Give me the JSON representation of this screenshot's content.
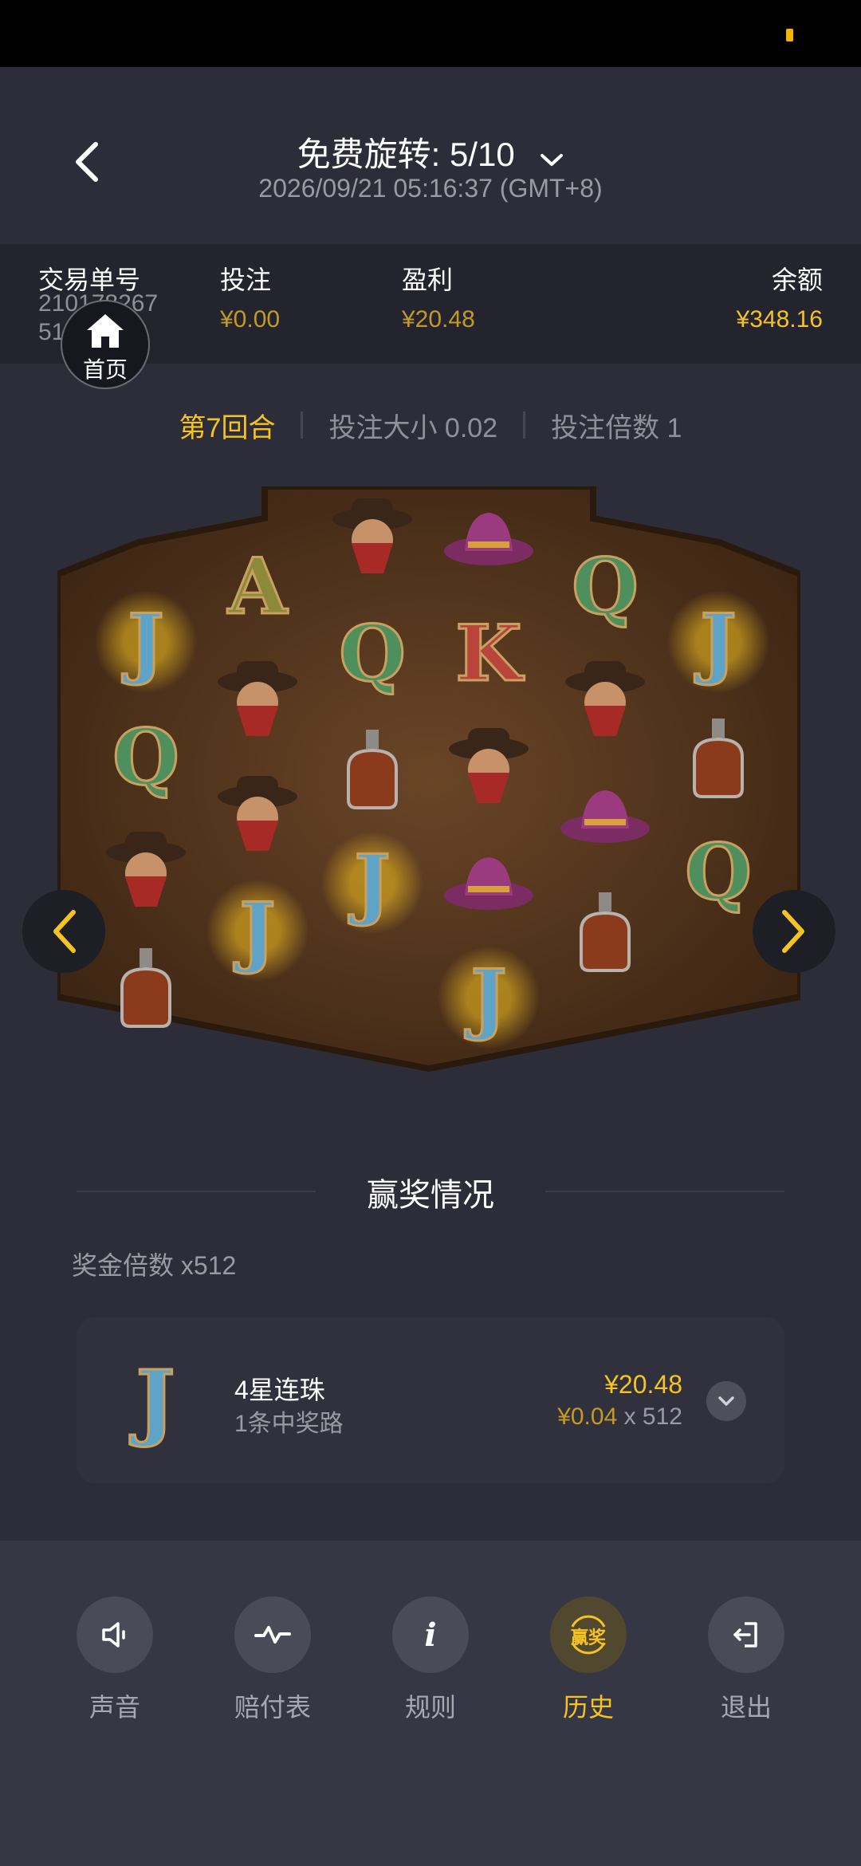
{
  "header": {
    "title": "免费旋转: 5/10",
    "timestamp": "2026/09/21 05:16:37 (GMT+8)"
  },
  "info": {
    "order_label": "交易单号",
    "order_line1": "210178267",
    "order_line2": "5110...113",
    "bet_label": "投注",
    "bet_value": "¥0.00",
    "profit_label": "盈利",
    "profit_value": "¥20.48",
    "balance_label": "余额",
    "balance_value": "¥348.16",
    "home_label": "首页"
  },
  "round": {
    "round_label": "第7回合",
    "bet_size": "投注大小 0.02",
    "bet_multiplier": "投注倍数 1"
  },
  "reels": [
    [
      "J",
      "Q",
      "bandit",
      "bottle"
    ],
    [
      "A",
      "bandit",
      "bandit",
      "J"
    ],
    [
      "bandit",
      "Q",
      "bottle",
      "J"
    ],
    [
      "hat",
      "K",
      "bandit",
      "hat",
      "J"
    ],
    [
      "Q",
      "bandit",
      "hat",
      "bottle"
    ],
    [
      "J",
      "bottle",
      "Q"
    ]
  ],
  "wins": {
    "title": "赢奖情况",
    "multiplier": "奖金倍数 x512",
    "item": {
      "symbol": "J",
      "name": "4星连珠",
      "lines": "1条中奖路",
      "amount": "¥20.48",
      "unit": "¥0.04",
      "times": " x 512"
    }
  },
  "toolbar": {
    "sound": "声音",
    "paytable": "赔付表",
    "rules": "规则",
    "history": "历史",
    "history_badge": "赢奖",
    "exit": "退出"
  },
  "colors": {
    "accent": "#f6c320",
    "gold_dim": "#c49a24",
    "background": "#2c2d38"
  }
}
